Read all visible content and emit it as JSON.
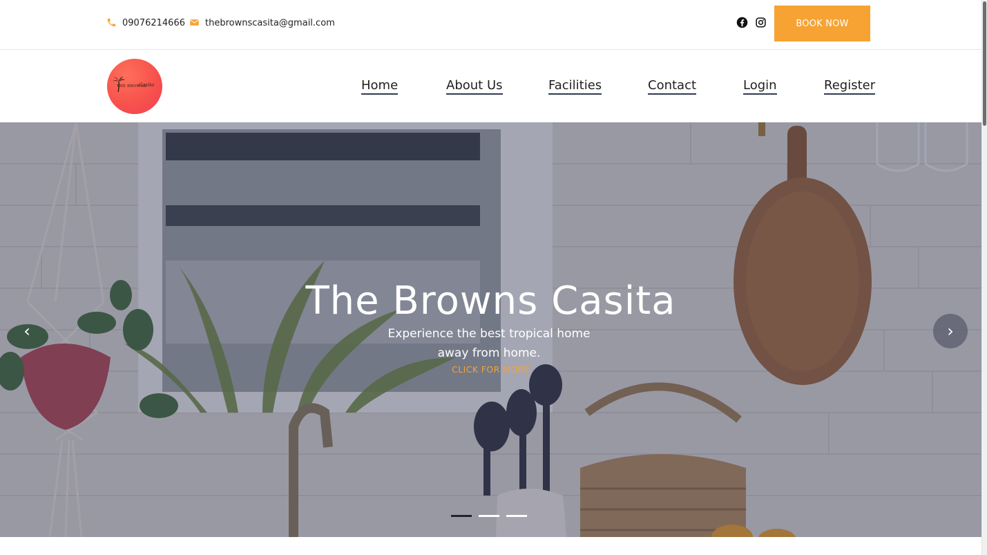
{
  "topbar": {
    "phone": "09076214666",
    "email": "thebrownscasita@gmail.com",
    "phone_icon": "phone-icon",
    "email_icon": "envelope-icon",
    "social": [
      "facebook-icon",
      "instagram-icon"
    ],
    "book_label": "BOOK NOW"
  },
  "logo": {
    "text": "THE BROWNS",
    "script": "Casita"
  },
  "nav": {
    "items": [
      {
        "label": "Home"
      },
      {
        "label": "About Us"
      },
      {
        "label": "Facilities"
      },
      {
        "label": "Contact"
      },
      {
        "label": "Login"
      },
      {
        "label": "Register"
      }
    ]
  },
  "hero": {
    "title": "The Browns Casita",
    "subtitle": "Experience the best tropical home away from home.",
    "link": "CLICK FOR MORE",
    "prev": "‹",
    "next": "›",
    "slide_count": 3,
    "active_slide": 1
  },
  "colors": {
    "accent": "#f6a334",
    "nav_underline": "#2e3b4e",
    "logo": "#f7524c"
  }
}
